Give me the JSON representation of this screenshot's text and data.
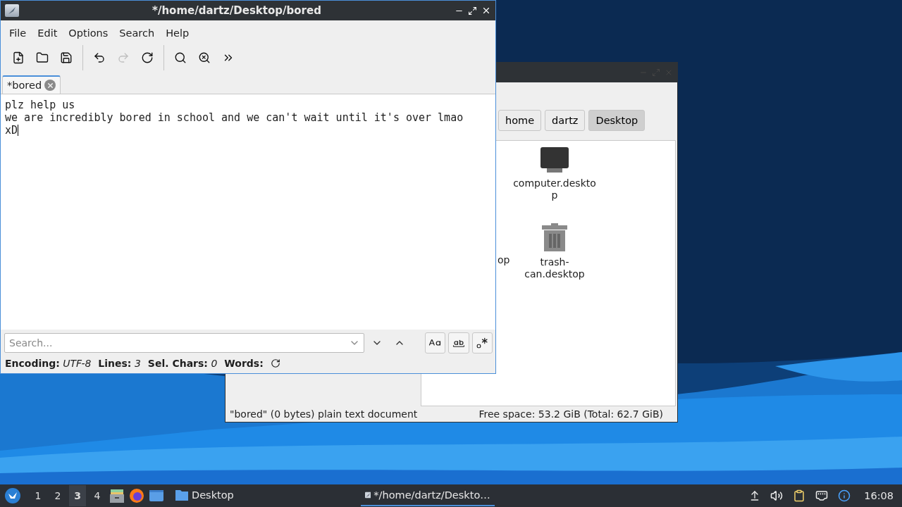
{
  "editor": {
    "title": "*/home/dartz/Desktop/bored",
    "menu": [
      "File",
      "Edit",
      "Options",
      "Search",
      "Help"
    ],
    "toolbar": [
      {
        "kind": "new",
        "disabled": false
      },
      {
        "kind": "open",
        "disabled": false
      },
      {
        "kind": "save",
        "disabled": false
      },
      {
        "kind": "separator"
      },
      {
        "kind": "undo",
        "disabled": false
      },
      {
        "kind": "redo",
        "disabled": true
      },
      {
        "kind": "reload",
        "disabled": false
      },
      {
        "kind": "separator"
      },
      {
        "kind": "find",
        "disabled": false
      },
      {
        "kind": "replace",
        "disabled": false
      },
      {
        "kind": "more",
        "disabled": false
      }
    ],
    "tabs": [
      {
        "label": "*bored",
        "selected": true
      }
    ],
    "lines": [
      "plz help us",
      "we are incredibly bored in school and we can't wait until it's over lmao",
      "xD"
    ],
    "search": {
      "placeholder": "Search..."
    },
    "search_options": [
      {
        "kind": "case"
      },
      {
        "kind": "whole-word"
      },
      {
        "kind": "regex"
      }
    ],
    "status": [
      {
        "label": "Encoding:",
        "value": "UTF-8"
      },
      {
        "label": "Lines:",
        "value": "3"
      },
      {
        "label": "Sel. Chars:",
        "value": "0"
      },
      {
        "label": "Words:"
      }
    ]
  },
  "file_manager": {
    "path": [
      {
        "label": "home",
        "selected": false
      },
      {
        "label": "dartz",
        "selected": false
      },
      {
        "label": "Desktop",
        "selected": true
      }
    ],
    "icons": [
      {
        "kind": "computer",
        "label": "computer.deskto\np"
      },
      {
        "kind": "trash",
        "label": "trash-\ncan.desktop"
      }
    ],
    "cut_label": "op",
    "status_left": "\"bored\" (0 bytes) plain text document",
    "status_right": "Free space: 53.2 GiB (Total: 62.7 GiB)"
  },
  "taskbar": {
    "workspaces": [
      {
        "label": "1",
        "selected": false
      },
      {
        "label": "2",
        "selected": false
      },
      {
        "label": "3",
        "selected": true
      },
      {
        "label": "4",
        "selected": false
      }
    ],
    "tasks": [
      {
        "kind": "folder",
        "label": "Desktop",
        "selected": false
      },
      {
        "kind": "editor",
        "label": "*/home/dartz/Deskto…",
        "selected": true
      }
    ],
    "clock": "16:08"
  }
}
